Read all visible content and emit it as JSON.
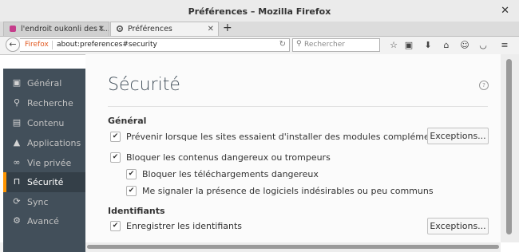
{
  "window": {
    "title": "Préférences – Mozilla Firefox",
    "close_glyph": "✕"
  },
  "tabs": [
    {
      "label": "l'endroit oukonli des t...",
      "close": "✕",
      "active": false
    },
    {
      "label": "Préférences",
      "close": "✕",
      "active": true
    }
  ],
  "new_tab_glyph": "+",
  "navbar": {
    "back_glyph": "←",
    "identity_label": "Firefox",
    "url": "about:preferences#security",
    "reload_glyph": "↻",
    "search_placeholder": "Rechercher",
    "icons": [
      "bookmark-star-icon",
      "reading-list-icon",
      "download-icon",
      "home-icon",
      "hello-icon",
      "pocket-icon",
      "menu-icon"
    ]
  },
  "sidebar": {
    "items": [
      {
        "label": "Général",
        "icon": "general-icon",
        "glyph": "▣",
        "selected": false
      },
      {
        "label": "Recherche",
        "icon": "search-icon",
        "glyph": "⚲",
        "selected": false
      },
      {
        "label": "Contenu",
        "icon": "content-icon",
        "glyph": "▤",
        "selected": false
      },
      {
        "label": "Applications",
        "icon": "applications-icon",
        "glyph": "▲",
        "selected": false
      },
      {
        "label": "Vie privée",
        "icon": "privacy-mask-icon",
        "glyph": "∞",
        "selected": false
      },
      {
        "label": "Sécurité",
        "icon": "security-lock-icon",
        "glyph": "⊓",
        "selected": true
      },
      {
        "label": "Sync",
        "icon": "sync-icon",
        "glyph": "⟳",
        "selected": false
      },
      {
        "label": "Avancé",
        "icon": "advanced-icon",
        "glyph": "⚙",
        "selected": false
      }
    ]
  },
  "main": {
    "title": "Sécurité",
    "help_glyph": "?",
    "sections": {
      "general": {
        "heading": "Général",
        "addons_label": "Prévenir lorsque les sites essaient d'installer des modules complémentaires",
        "addons_checked": true,
        "addons_exceptions": "Exceptions...",
        "block_dangerous_label": "Bloquer les contenus dangereux ou trompeurs",
        "block_dangerous_checked": true,
        "block_downloads_label": "Bloquer les téléchargements dangereux",
        "block_downloads_checked": true,
        "warn_unwanted_label": "Me signaler la présence de logiciels indésirables ou peu communs",
        "warn_unwanted_checked": true
      },
      "identifiers": {
        "heading": "Identifiants",
        "save_logins_label": "Enregistrer les identifiants",
        "save_logins_checked": true,
        "exceptions": "Exceptions..."
      }
    }
  },
  "colors": {
    "sidebar": "#424f5a",
    "sidebar_selected": "#343f48",
    "accent": "#ff9500",
    "title": "#424f5a"
  }
}
